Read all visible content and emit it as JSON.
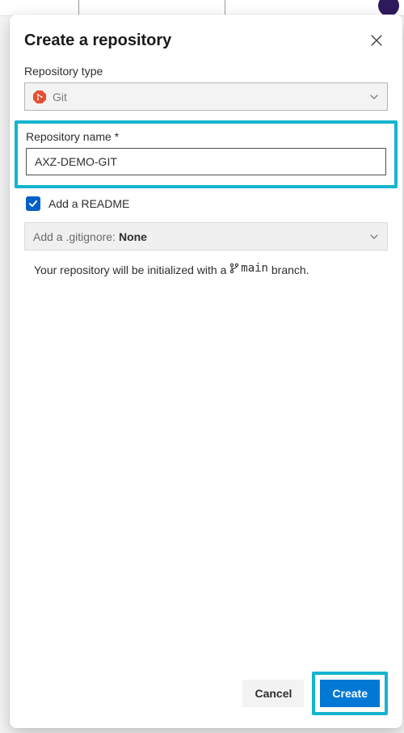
{
  "dialog": {
    "title": "Create a repository",
    "repo_type_label": "Repository type",
    "repo_type_value": "Git",
    "repo_name_label": "Repository name *",
    "repo_name_value": "AXZ-DEMO-GIT",
    "readme_label": "Add a README",
    "readme_checked": true,
    "gitignore_prefix": "Add a .gitignore:",
    "gitignore_value": "None",
    "info_prefix": "Your repository will be initialized with a ",
    "info_branch": "main",
    "info_suffix": " branch."
  },
  "buttons": {
    "cancel": "Cancel",
    "create": "Create"
  },
  "icons": {
    "close": "close-icon",
    "git": "git-icon",
    "chevron_down": "chevron-down-icon",
    "check": "check-icon",
    "branch": "branch-icon"
  }
}
